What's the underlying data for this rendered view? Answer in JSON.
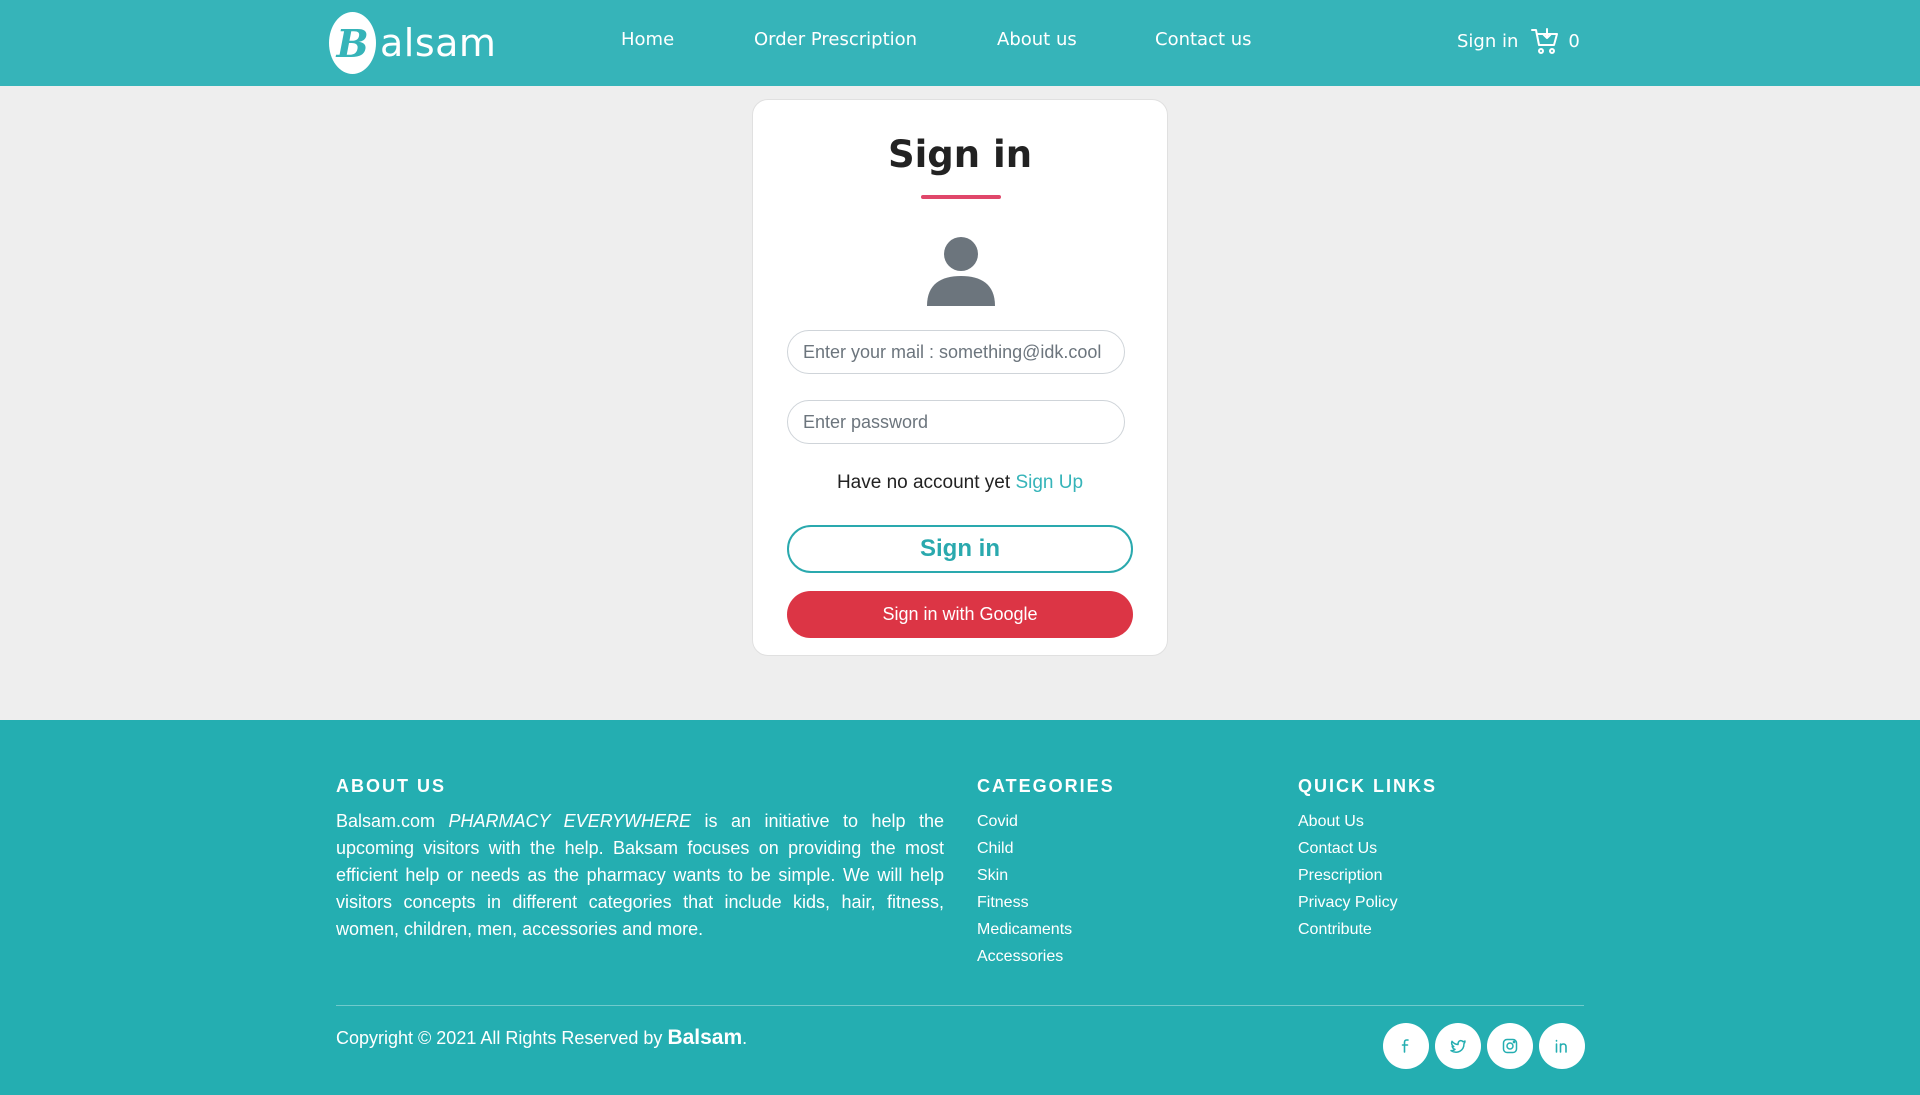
{
  "nav": {
    "logo_letter": "B",
    "logo_text": "alsam",
    "links": [
      "Home",
      "Order Prescription",
      "About us",
      "Contact us"
    ],
    "signin": "Sign in",
    "cart_count": "0"
  },
  "card": {
    "title": "Sign in",
    "email_placeholder": "Enter your mail : something@idk.cool",
    "password_placeholder": "Enter password",
    "no_account_text": "Have no account yet",
    "signup_link": "Sign Up",
    "signin_button": "Sign in",
    "google_button": "Sign in with Google"
  },
  "footer": {
    "about_heading": "ABOUT US",
    "about_brand": "Balsam.com",
    "about_tagline": "PHARMACY EVERYWHERE",
    "about_text": "is an initiative to help the upcoming visitors with the help. Baksam focuses on providing the most efficient help or needs as the pharmacy wants to be simple. We will help visitors concepts in different categories that include kids, hair, fitness, women, children, men, accessories and more.",
    "categories_heading": "CATEGORIES",
    "categories": [
      "Covid",
      "Child",
      "Skin",
      "Fitness",
      "Medicaments",
      "Accessories"
    ],
    "quick_links_heading": "QUICK LINKS",
    "quick_links": [
      "About Us",
      "Contact Us",
      "Prescription",
      "Privacy Policy",
      "Contribute"
    ],
    "copyright_prefix": "Copyright © 2021 All Rights Reserved by",
    "copyright_brand": "Balsam",
    "copyright_suffix": "."
  },
  "colors": {
    "nav_bg": "#36b4b9",
    "footer_bg": "#24aeb1",
    "accent": "#2aa9ae",
    "google": "#dc3545",
    "underline": "#e0476a"
  },
  "icons": [
    "shopping-cart-icon",
    "user-icon",
    "facebook-icon",
    "twitter-icon",
    "instagram-icon",
    "linkedin-icon"
  ]
}
